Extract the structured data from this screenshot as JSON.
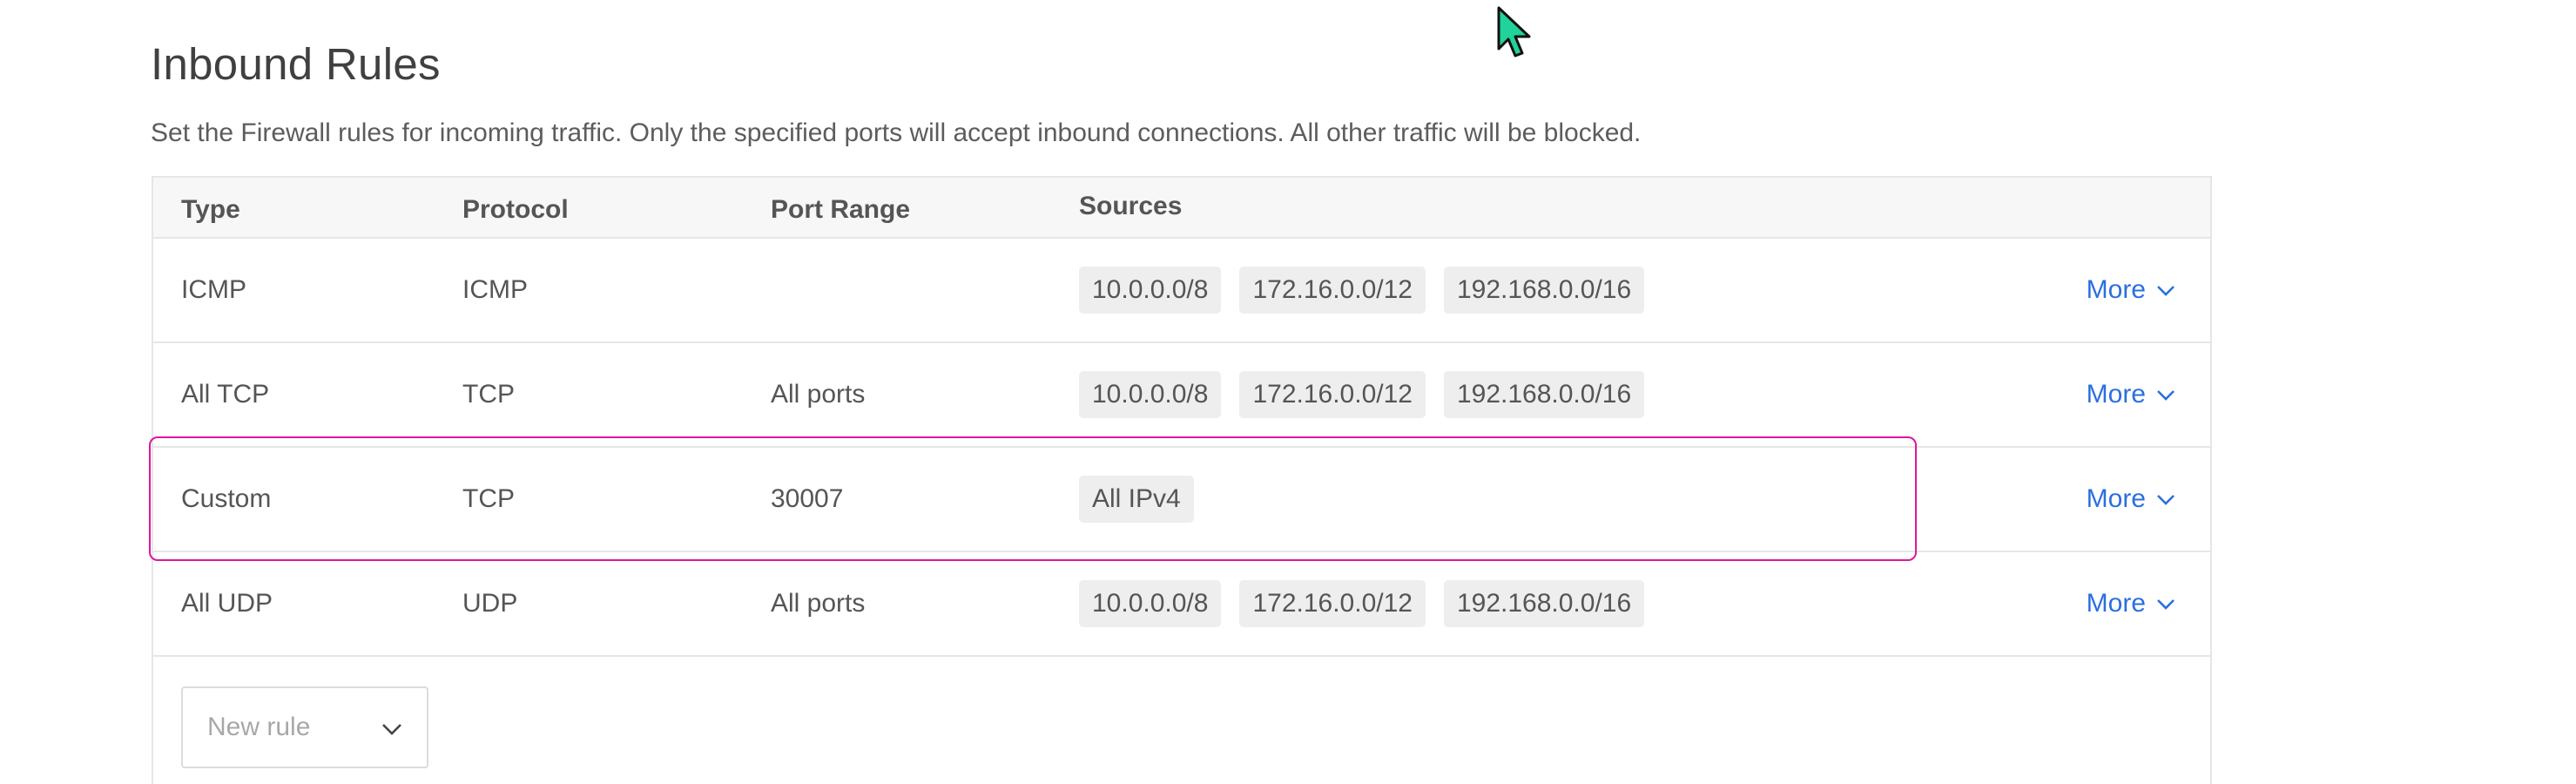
{
  "page": {
    "title": "Inbound Rules",
    "description": "Set the Firewall rules for incoming traffic. Only the specified ports will accept inbound connections. All other traffic will be blocked."
  },
  "table": {
    "headers": {
      "type": "Type",
      "protocol": "Protocol",
      "port_range": "Port Range",
      "sources": "Sources"
    },
    "rows": [
      {
        "type": "ICMP",
        "protocol": "ICMP",
        "port_range": "",
        "sources": [
          "10.0.0.0/8",
          "172.16.0.0/12",
          "192.168.0.0/16"
        ],
        "action": "More"
      },
      {
        "type": "All TCP",
        "protocol": "TCP",
        "port_range": "All ports",
        "sources": [
          "10.0.0.0/8",
          "172.16.0.0/12",
          "192.168.0.0/16"
        ],
        "action": "More"
      },
      {
        "type": "Custom",
        "protocol": "TCP",
        "port_range": "30007",
        "sources": [
          "All IPv4"
        ],
        "action": "More"
      },
      {
        "type": "All UDP",
        "protocol": "UDP",
        "port_range": "All ports",
        "sources": [
          "10.0.0.0/8",
          "172.16.0.0/12",
          "192.168.0.0/16"
        ],
        "action": "More"
      }
    ]
  },
  "new_rule": {
    "placeholder": "New rule"
  },
  "colors": {
    "link": "#2b6fe0",
    "highlight": "#e0169b",
    "cursor": "#1fd39a"
  },
  "icons": {
    "more_chevron": "chevron-down-icon",
    "select_chevron": "chevron-down-icon",
    "cursor": "mouse-pointer-icon"
  }
}
